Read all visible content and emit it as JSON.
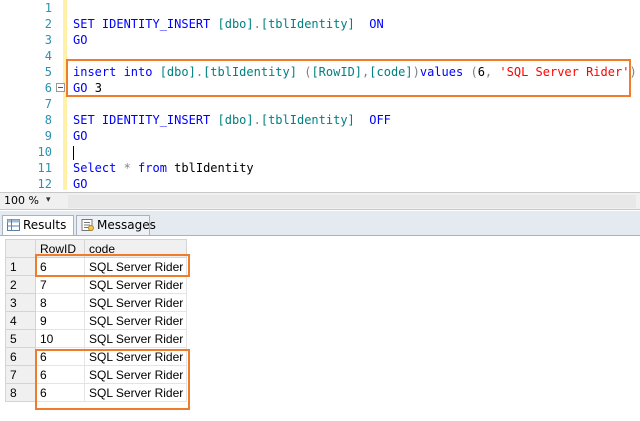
{
  "editor": {
    "lines": [
      {
        "n": "1",
        "tokens": []
      },
      {
        "n": "2",
        "tokens": [
          {
            "c": "kw",
            "t": "SET IDENTITY_INSERT "
          },
          {
            "c": "ident",
            "t": "[dbo]"
          },
          {
            "c": "gray",
            "t": "."
          },
          {
            "c": "ident",
            "t": "[tblIdentity]"
          },
          {
            "c": "plain",
            "t": "  "
          },
          {
            "c": "kw",
            "t": "ON"
          }
        ]
      },
      {
        "n": "3",
        "tokens": [
          {
            "c": "kw",
            "t": "GO"
          }
        ]
      },
      {
        "n": "4",
        "tokens": []
      },
      {
        "n": "5",
        "tokens": [
          {
            "c": "kw",
            "t": "insert into "
          },
          {
            "c": "ident",
            "t": "[dbo]"
          },
          {
            "c": "gray",
            "t": "."
          },
          {
            "c": "ident",
            "t": "[tblIdentity]"
          },
          {
            "c": "plain",
            "t": " "
          },
          {
            "c": "gray",
            "t": "("
          },
          {
            "c": "ident",
            "t": "[RowID]"
          },
          {
            "c": "gray",
            "t": ","
          },
          {
            "c": "ident",
            "t": "[code]"
          },
          {
            "c": "gray",
            "t": ")"
          },
          {
            "c": "kw",
            "t": "values"
          },
          {
            "c": "plain",
            "t": " "
          },
          {
            "c": "gray",
            "t": "("
          },
          {
            "c": "plain",
            "t": "6"
          },
          {
            "c": "gray",
            "t": ","
          },
          {
            "c": "plain",
            "t": " "
          },
          {
            "c": "str",
            "t": "'SQL Server Rider'"
          },
          {
            "c": "gray",
            "t": ")"
          }
        ]
      },
      {
        "n": "6",
        "tokens": [
          {
            "c": "kw",
            "t": "GO "
          },
          {
            "c": "plain",
            "t": "3"
          }
        ]
      },
      {
        "n": "7",
        "tokens": []
      },
      {
        "n": "8",
        "tokens": [
          {
            "c": "kw",
            "t": "SET IDENTITY_INSERT "
          },
          {
            "c": "ident",
            "t": "[dbo]"
          },
          {
            "c": "gray",
            "t": "."
          },
          {
            "c": "ident",
            "t": "[tblIdentity]"
          },
          {
            "c": "plain",
            "t": "  "
          },
          {
            "c": "kw",
            "t": "OFF"
          }
        ]
      },
      {
        "n": "9",
        "tokens": [
          {
            "c": "kw",
            "t": "GO"
          }
        ]
      },
      {
        "n": "10",
        "tokens": []
      },
      {
        "n": "11",
        "tokens": [
          {
            "c": "kw",
            "t": "Select "
          },
          {
            "c": "gray",
            "t": "*"
          },
          {
            "c": "plain",
            "t": " "
          },
          {
            "c": "kw",
            "t": "from "
          },
          {
            "c": "plain",
            "t": "tblIdentity"
          }
        ]
      },
      {
        "n": "12",
        "tokens": [
          {
            "c": "kw",
            "t": "GO"
          }
        ]
      }
    ]
  },
  "statusbar": {
    "zoom": "100 %",
    "zoom_arrow": "▾"
  },
  "tabs": {
    "results": "Results",
    "messages": "Messages"
  },
  "grid": {
    "columns": [
      "RowID",
      "code"
    ],
    "rows": [
      {
        "n": "1",
        "rowid": "6",
        "code": "SQL Server Rider"
      },
      {
        "n": "2",
        "rowid": "7",
        "code": "SQL Server Rider"
      },
      {
        "n": "3",
        "rowid": "8",
        "code": "SQL Server Rider"
      },
      {
        "n": "4",
        "rowid": "9",
        "code": "SQL Server Rider"
      },
      {
        "n": "5",
        "rowid": "10",
        "code": "SQL Server Rider"
      },
      {
        "n": "6",
        "rowid": "6",
        "code": "SQL Server Rider"
      },
      {
        "n": "7",
        "rowid": "6",
        "code": "SQL Server Rider"
      },
      {
        "n": "8",
        "rowid": "6",
        "code": "SQL Server Rider"
      }
    ]
  },
  "colors": {
    "highlight": "#ee7c2c",
    "keyword": "#0000ff",
    "identifier": "#008080",
    "string": "#ff0000",
    "line_number": "#2b91af"
  }
}
